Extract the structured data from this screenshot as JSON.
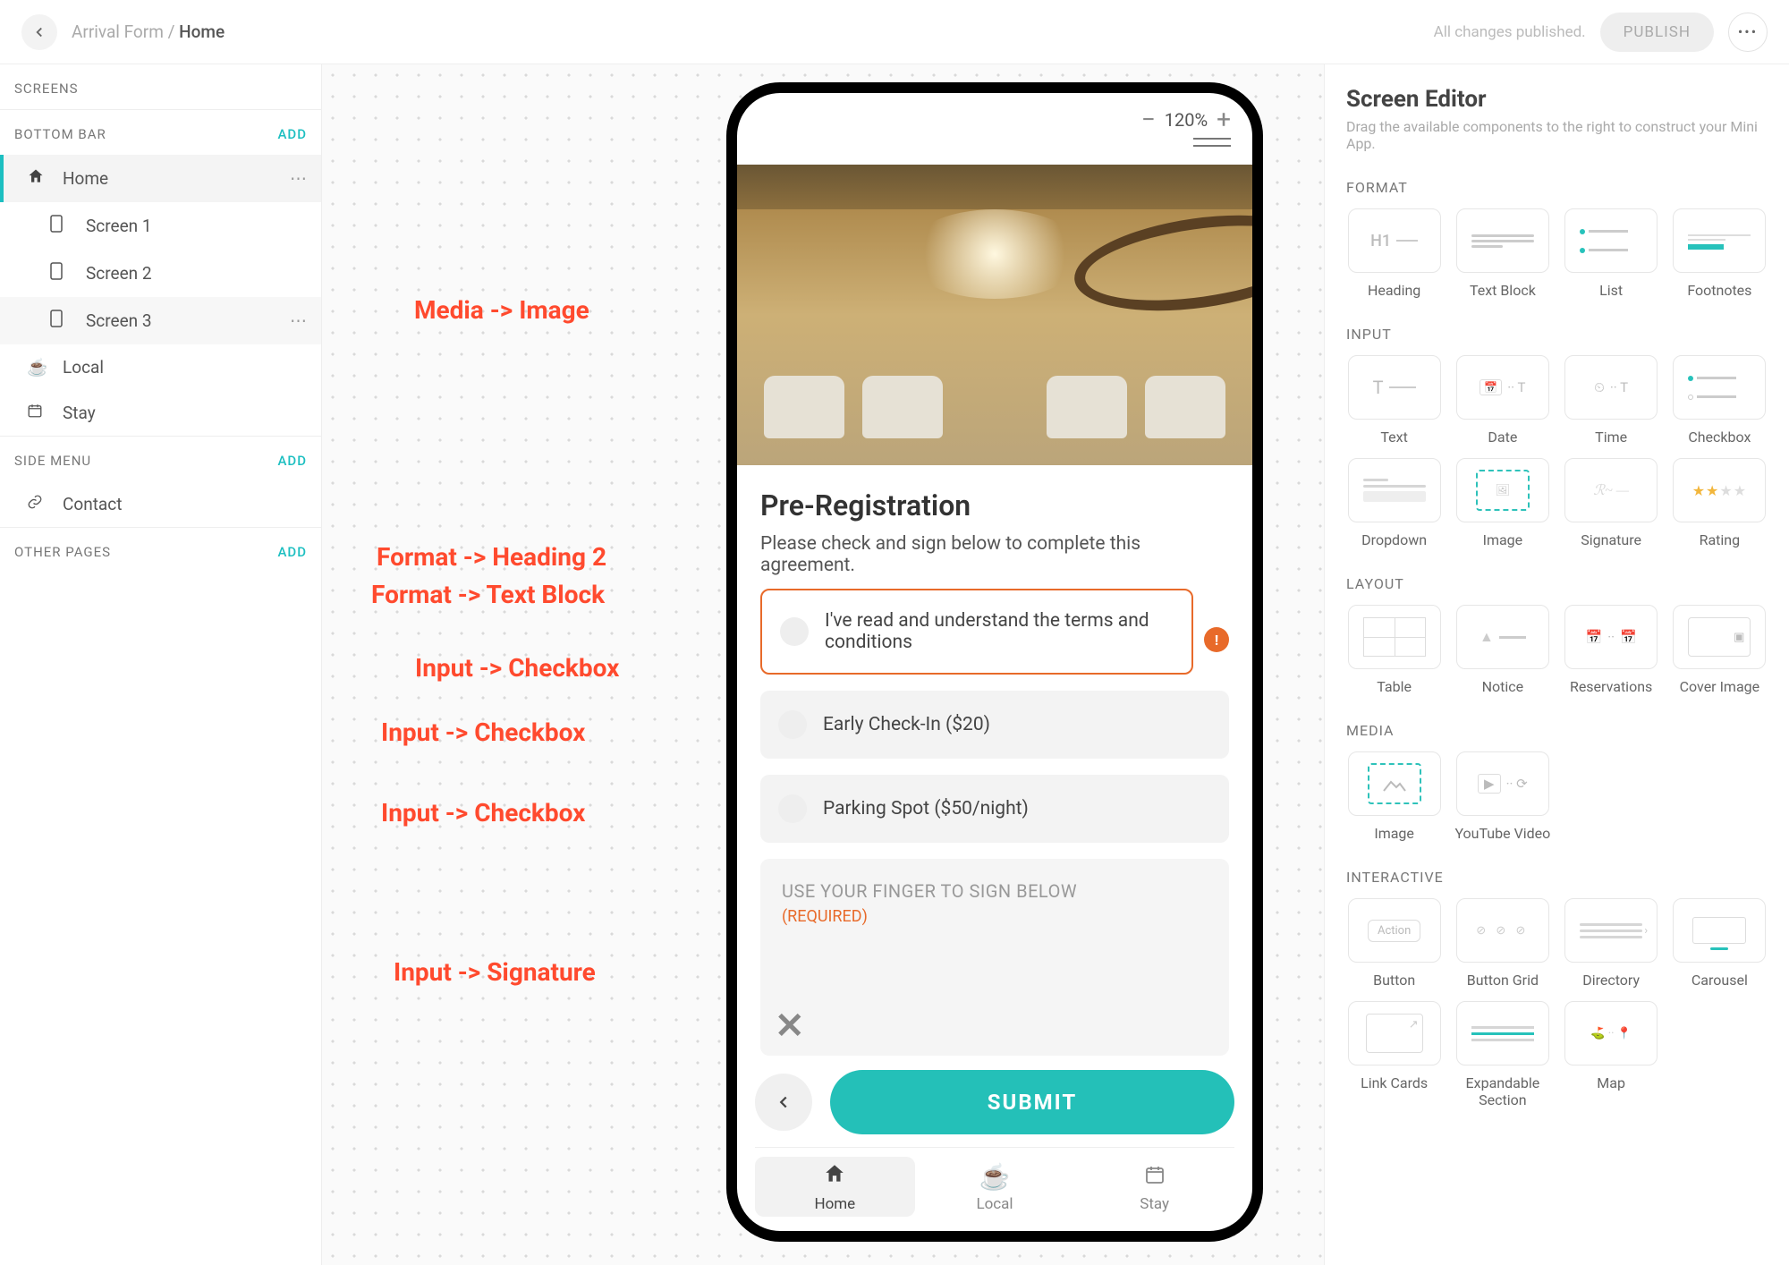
{
  "topbar": {
    "breadcrumb_root": "Arrival Form",
    "breadcrumb_current": "Home",
    "status": "All changes published.",
    "publish_label": "PUBLISH"
  },
  "sidebar": {
    "sections": {
      "screens": "SCREENS",
      "bottom_bar": "BOTTOM BAR",
      "side_menu": "SIDE MENU",
      "other_pages": "OTHER PAGES"
    },
    "add_label": "ADD",
    "items": {
      "home": "Home",
      "screen1": "Screen 1",
      "screen2": "Screen 2",
      "screen3": "Screen 3",
      "local": "Local",
      "stay": "Stay",
      "contact": "Contact"
    }
  },
  "canvas": {
    "zoom": "120%",
    "annotations": {
      "a1": "Media -> Image",
      "a2": "Format -> Heading 2",
      "a3": "Format -> Text Block",
      "a4": "Input -> Checkbox",
      "a5": "Input -> Checkbox",
      "a6": "Input -> Checkbox",
      "a7": "Input -> Signature"
    }
  },
  "phone": {
    "heading": "Pre-Registration",
    "subtitle": "Please check and sign below to complete this agreement.",
    "checkbox1": "I've read and understand the terms and conditions",
    "checkbox2": "Early Check-In ($20)",
    "checkbox3": "Parking Spot ($50/night)",
    "signature_hint": "USE YOUR FINGER TO SIGN BELOW",
    "signature_required": "(REQUIRED)",
    "submit": "SUBMIT",
    "tabs": {
      "home": "Home",
      "local": "Local",
      "stay": "Stay"
    }
  },
  "panel": {
    "title": "Screen Editor",
    "desc": "Drag the available components to the right to construct your Mini App.",
    "groups": {
      "format": "FORMAT",
      "input": "INPUT",
      "layout": "LAYOUT",
      "media": "MEDIA",
      "interactive": "INTERACTIVE"
    },
    "components": {
      "heading": "Heading",
      "text_block": "Text Block",
      "list": "List",
      "footnotes": "Footnotes",
      "text": "Text",
      "date": "Date",
      "time": "Time",
      "checkbox": "Checkbox",
      "dropdown": "Dropdown",
      "image_input": "Image",
      "signature": "Signature",
      "rating": "Rating",
      "table": "Table",
      "notice": "Notice",
      "reservations": "Reservations",
      "cover_image": "Cover Image",
      "media_image": "Image",
      "youtube": "YouTube Video",
      "button": "Button",
      "button_grid": "Button Grid",
      "directory": "Directory",
      "carousel": "Carousel",
      "link_cards": "Link Cards",
      "expandable_section": "Expandable Section",
      "map": "Map"
    }
  }
}
